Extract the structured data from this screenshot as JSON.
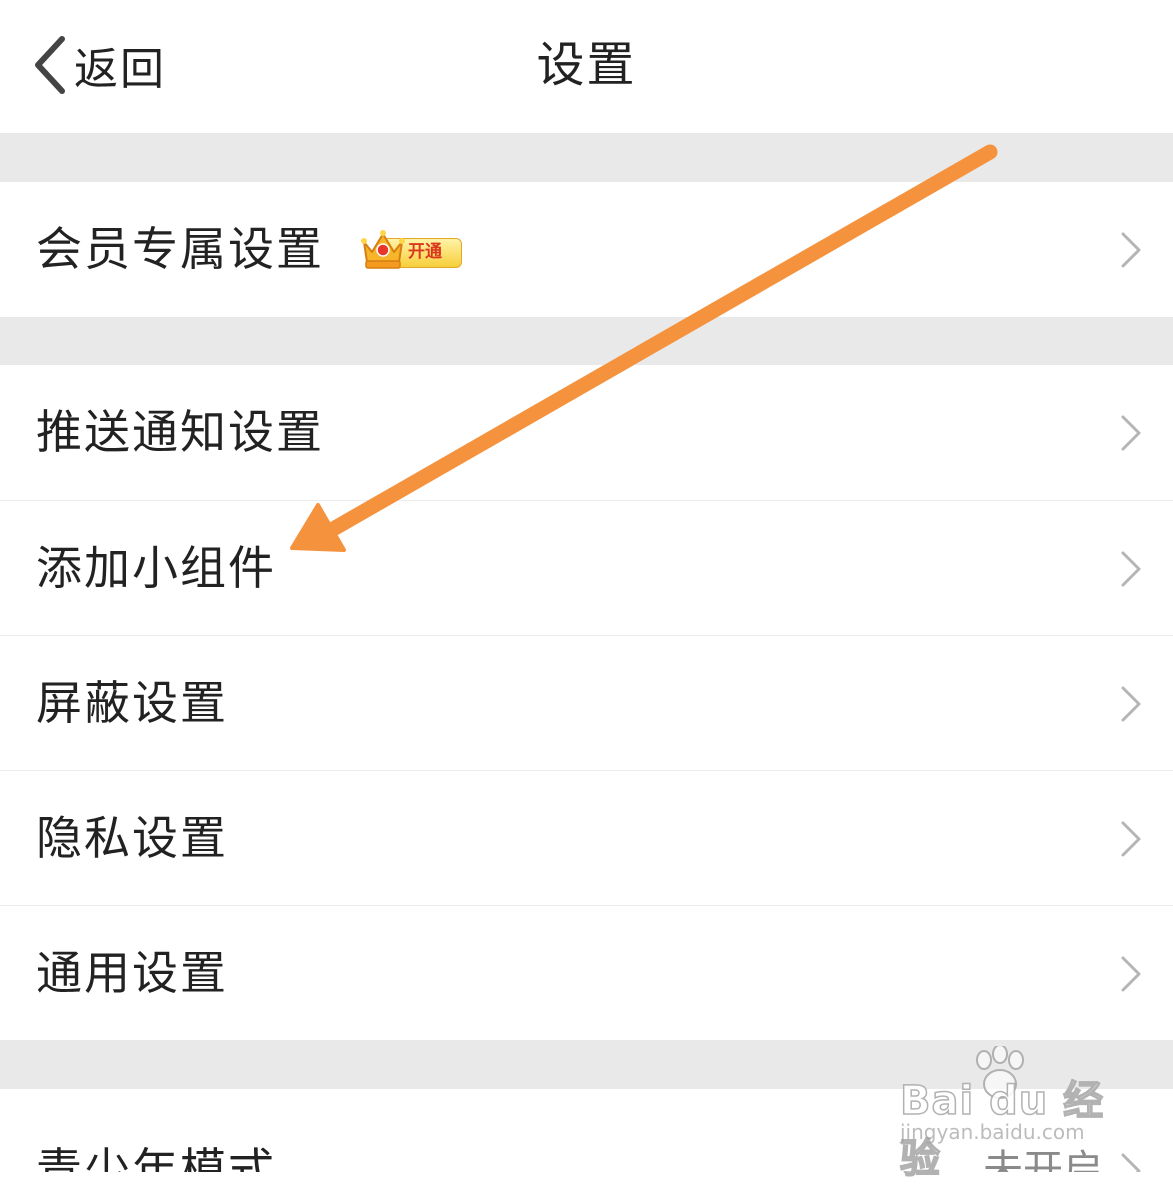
{
  "header": {
    "back_label": "返回",
    "title": "设置"
  },
  "sections": [
    {
      "items": [
        {
          "label": "会员专属设置",
          "badge": {
            "text": "开通",
            "icon": "crown-icon"
          },
          "icon": "chevron-right-icon"
        }
      ]
    },
    {
      "items": [
        {
          "label": "推送通知设置",
          "icon": "chevron-right-icon"
        },
        {
          "label": "添加小组件",
          "icon": "chevron-right-icon"
        },
        {
          "label": "屏蔽设置",
          "icon": "chevron-right-icon"
        },
        {
          "label": "隐私设置",
          "icon": "chevron-right-icon"
        },
        {
          "label": "通用设置",
          "icon": "chevron-right-icon"
        }
      ]
    },
    {
      "items": [
        {
          "label": "青少年模式",
          "value": "未开启",
          "icon": "chevron-right-icon"
        }
      ]
    }
  ],
  "annotation": {
    "type": "arrow",
    "color": "#f5923e",
    "points_to": "添加小组件"
  },
  "watermark": {
    "brand": "Bai du 经验",
    "sub": "jingyan.baidu.com"
  },
  "colors": {
    "background": "#ffffff",
    "section_gap": "#e9e9e9",
    "text": "#222222",
    "secondary_text": "#8a8a8a",
    "chevron": "#b5b5b5",
    "arrow": "#f5923e"
  }
}
